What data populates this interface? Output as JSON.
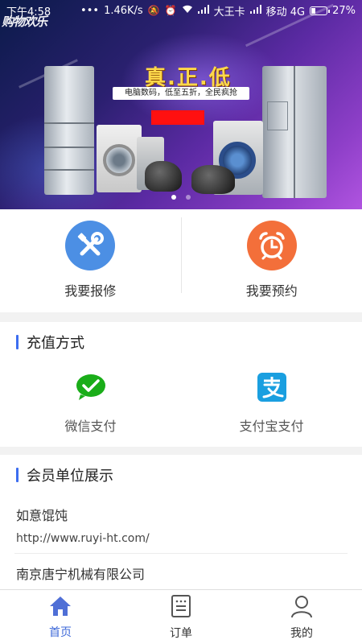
{
  "status_bar": {
    "time": "下午4:58",
    "dots": "•••",
    "network_speed": "1.46K/s",
    "carrier1": "大王卡",
    "carrier2": "移动 4G",
    "battery": "27%",
    "battery_level": 0.27
  },
  "banner": {
    "brand_text": "购物欢乐",
    "headline": "真.正.低",
    "subline": "电脑数码，低至五折，全民疯抢",
    "slide_count": 2,
    "active_slide": 0
  },
  "quick_actions": [
    {
      "label": "我要报修",
      "icon": "tools-icon",
      "color": "#4c8fe4"
    },
    {
      "label": "我要预约",
      "icon": "alarm-clock-icon",
      "color": "#f36f3a"
    }
  ],
  "payment": {
    "title": "充值方式",
    "methods": [
      {
        "label": "微信支付",
        "icon": "wechat-pay-icon",
        "color": "#1aad19"
      },
      {
        "label": "支付宝支付",
        "icon": "alipay-icon",
        "color": "#1a9fe0"
      }
    ]
  },
  "members": {
    "title": "会员单位展示",
    "items": [
      {
        "name": "如意馄饨",
        "url": "http://www.ruyi-ht.com/"
      },
      {
        "name": "南京唐宁机械有限公司",
        "url": ""
      }
    ]
  },
  "tabbar": {
    "tabs": [
      {
        "label": "首页",
        "icon": "home-icon",
        "active": true
      },
      {
        "label": "订单",
        "icon": "order-list-icon",
        "active": false
      },
      {
        "label": "我的",
        "icon": "profile-icon",
        "active": false
      }
    ]
  },
  "colors": {
    "accent": "#3d68d8",
    "section_marker": "#3c6df0"
  }
}
